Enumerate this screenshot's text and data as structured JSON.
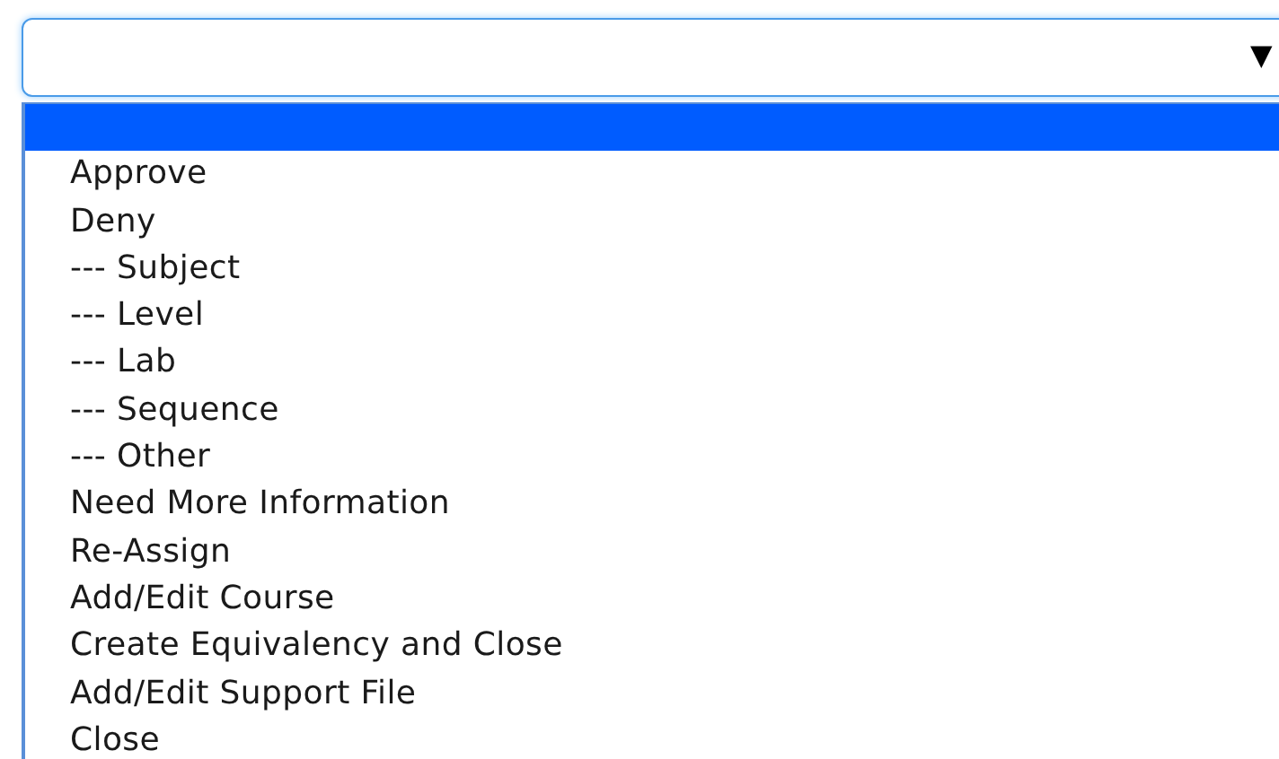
{
  "select": {
    "arrow": "▼"
  },
  "options": [
    {
      "selected": true
    },
    {
      "label": "Approve",
      "selected": false
    },
    {
      "label": "Deny",
      "selected": false
    },
    {
      "label": "--- Subject",
      "selected": false
    },
    {
      "label": "--- Level",
      "selected": false
    },
    {
      "label": "--- Lab",
      "selected": false
    },
    {
      "label": "--- Sequence",
      "selected": false
    },
    {
      "label": "--- Other",
      "selected": false
    },
    {
      "label": "Need More Information",
      "selected": false
    },
    {
      "label": "Re-Assign",
      "selected": false
    },
    {
      "label": "Add/Edit Course",
      "selected": false
    },
    {
      "label": "Create Equivalency and Close",
      "selected": false
    },
    {
      "label": "Add/Edit Support File",
      "selected": false
    },
    {
      "label": "Close",
      "selected": false
    }
  ]
}
